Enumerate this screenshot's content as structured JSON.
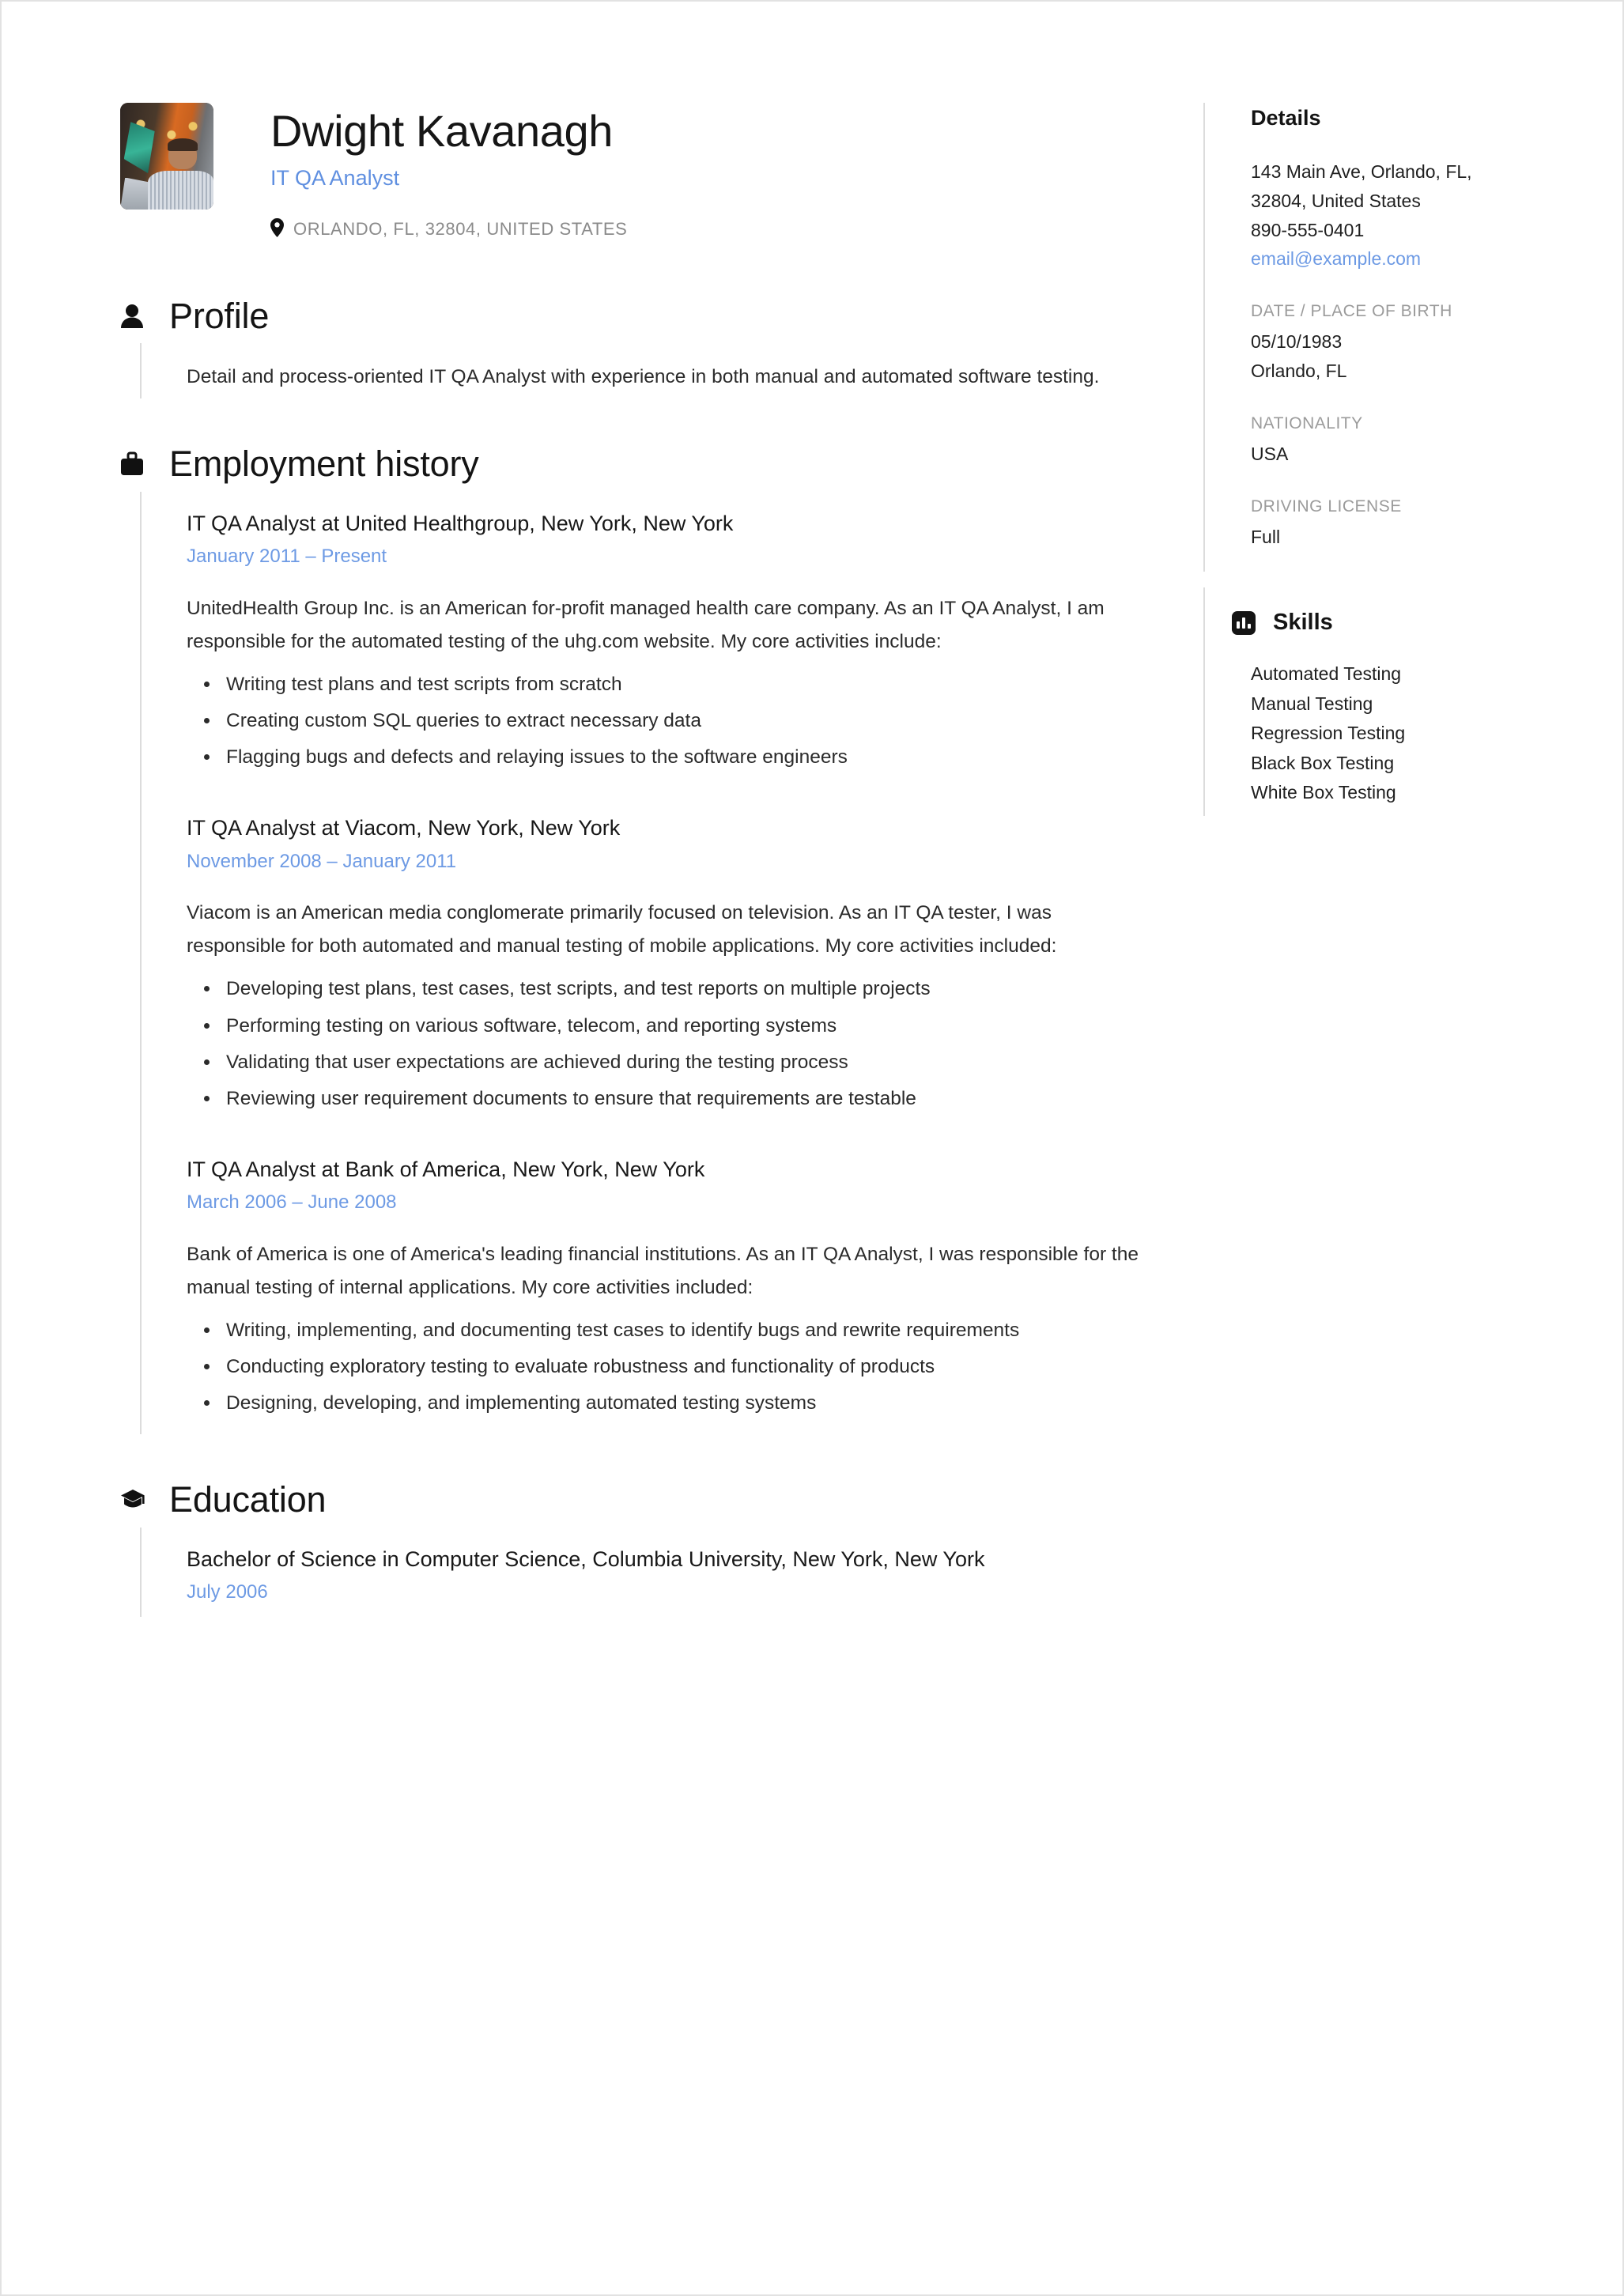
{
  "header": {
    "name": "Dwight Kavanagh",
    "job_title": "IT QA Analyst",
    "location": "ORLANDO, FL, 32804, UNITED STATES",
    "location_icon": "map-pin-icon",
    "photo_alt": "profile-photo"
  },
  "accent_color": "#6d9ae4",
  "sections": {
    "profile": {
      "icon": "person-icon",
      "title": "Profile",
      "text": "Detail and process-oriented IT QA Analyst with experience in both manual and automated software testing."
    },
    "employment": {
      "icon": "briefcase-icon",
      "title": "Employment history",
      "entries": [
        {
          "title": "IT QA Analyst at United Healthgroup, New York, New York",
          "dates": "January 2011  –  Present",
          "description": "UnitedHealth Group Inc. is an American for-profit managed health care company. As an IT QA Analyst, I am responsible for the automated testing of the uhg.com website. My core activities include:",
          "bullets": [
            "Writing test plans and test scripts from scratch",
            "Creating custom SQL queries to extract necessary data",
            "Flagging bugs and defects and relaying issues to the software engineers"
          ]
        },
        {
          "title": "IT QA Analyst at Viacom, New York, New York",
          "dates": "November 2008  –  January 2011",
          "description": "Viacom is an American media conglomerate primarily focused on television. As an IT QA tester, I was responsible for both automated and manual testing of mobile applications. My core activities included:",
          "bullets": [
            "Developing test plans, test cases, test scripts, and test reports on multiple projects",
            "Performing testing on various software, telecom, and reporting systems",
            "Validating that user expectations are achieved during the testing process",
            "Reviewing user requirement documents to ensure that requirements are testable"
          ]
        },
        {
          "title": "IT QA Analyst at Bank of America, New York, New York",
          "dates": "March 2006  –  June 2008",
          "description": "Bank of America is one of America's leading financial institutions. As an IT QA Analyst, I was responsible for the manual testing of internal applications. My core activities included:",
          "bullets": [
            "Writing, implementing, and documenting test cases to identify bugs and rewrite requirements",
            "Conducting exploratory testing to evaluate robustness and functionality of products",
            "Designing, developing, and implementing automated testing systems"
          ]
        }
      ]
    },
    "education": {
      "icon": "graduation-cap-icon",
      "title": "Education",
      "entries": [
        {
          "title": "Bachelor of Science in Computer Science, Columbia University, New York, New York",
          "dates": "July 2006"
        }
      ]
    }
  },
  "sidebar": {
    "details": {
      "title": "Details",
      "address": "143 Main Ave, Orlando, FL, 32804, United States",
      "phone": "890-555-0401",
      "email": "email@example.com",
      "dob_label": "DATE / PLACE OF BIRTH",
      "dob_date": "05/10/1983",
      "dob_place": "Orlando, FL",
      "nationality_label": "NATIONALITY",
      "nationality": "USA",
      "driving_label": "DRIVING LICENSE",
      "driving": "Full"
    },
    "skills": {
      "icon": "bar-chart-icon",
      "title": "Skills",
      "items": [
        "Automated Testing",
        "Manual Testing",
        "Regression Testing",
        "Black Box Testing",
        "White Box Testing"
      ]
    }
  }
}
